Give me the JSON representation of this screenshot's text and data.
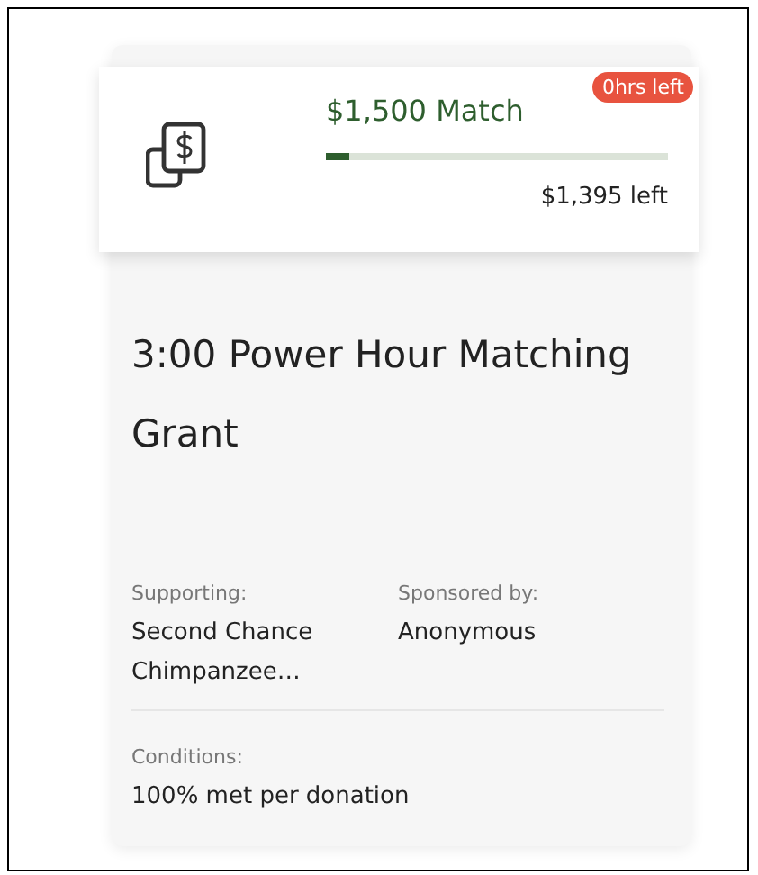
{
  "match": {
    "title": "$1,500 Match",
    "badge": "0hrs left",
    "level": 0.07,
    "remaining": "$1,395 left"
  },
  "grant": {
    "title": "3:00 Power Hour Matching Grant"
  },
  "details": [
    {
      "label": "Supporting:",
      "value": "Second Chance Chimpanzee…"
    },
    {
      "label": "Sponsored by:",
      "value": "Anonymous"
    }
  ],
  "conditions": {
    "label": "Conditions:",
    "value": "100% met per donation"
  }
}
